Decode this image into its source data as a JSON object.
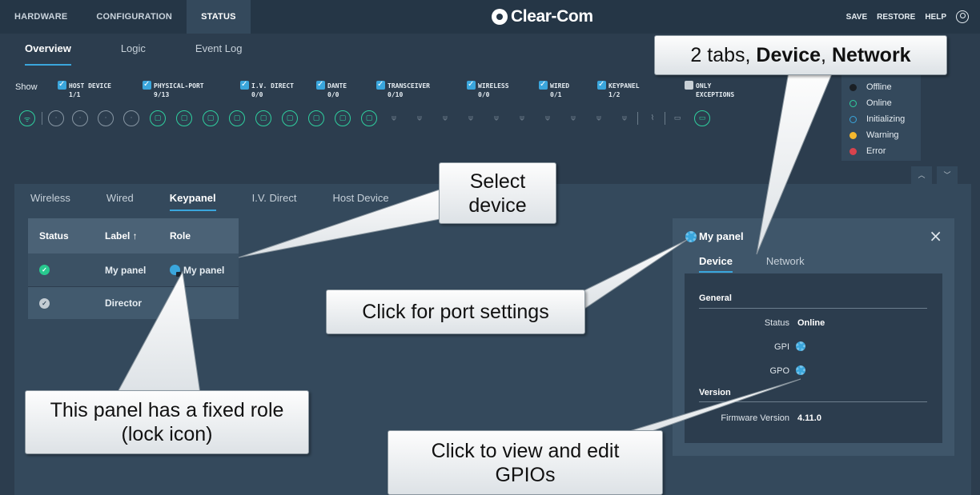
{
  "topnav": {
    "tabs": [
      {
        "label": "HARDWARE"
      },
      {
        "label": "CONFIGURATION"
      },
      {
        "label": "STATUS"
      }
    ],
    "brand": "Clear-Com",
    "actions": {
      "save": "SAVE",
      "restore": "RESTORE",
      "help": "HELP"
    }
  },
  "subnav": {
    "tabs": [
      {
        "label": "Overview"
      },
      {
        "label": "Logic"
      },
      {
        "label": "Event Log"
      }
    ]
  },
  "filters": {
    "show_label": "Show",
    "items": [
      {
        "label": "HOST DEVICE",
        "count": "1/1",
        "checked": true
      },
      {
        "label": "PHYSICAL-PORT",
        "count": "9/13",
        "checked": true
      },
      {
        "label": "I.V. DIRECT",
        "count": "0/0",
        "checked": true
      },
      {
        "label": "DANTE",
        "count": "0/0",
        "checked": true
      },
      {
        "label": "TRANSCEIVER",
        "count": "0/10",
        "checked": true
      },
      {
        "label": "WIRELESS",
        "count": "0/0",
        "checked": true
      },
      {
        "label": "WIRED",
        "count": "0/1",
        "checked": true
      },
      {
        "label": "KEYPANEL",
        "count": "1/2",
        "checked": true
      },
      {
        "label": "ONLY",
        "label2": "EXCEPTIONS",
        "checked": false
      }
    ]
  },
  "legend": {
    "items": [
      {
        "label": "Offline",
        "color": "#1a1f24"
      },
      {
        "label": "Online",
        "color": "#2fcf9f"
      },
      {
        "label": "Initializing",
        "color": "#3aa6dc"
      },
      {
        "label": "Warning",
        "color": "#f5b82e"
      },
      {
        "label": "Error",
        "color": "#d9434d"
      }
    ]
  },
  "device_tabs": [
    {
      "label": "Wireless"
    },
    {
      "label": "Wired"
    },
    {
      "label": "Keypanel"
    },
    {
      "label": "I.V. Direct"
    },
    {
      "label": "Host Device"
    }
  ],
  "device_table": {
    "headers": {
      "status": "Status",
      "label": "Label ↑",
      "role": "Role"
    },
    "rows": [
      {
        "label": "My panel",
        "role": "My panel",
        "status": "online"
      },
      {
        "label": "Director",
        "role": "",
        "status": "offline"
      }
    ]
  },
  "detail": {
    "title": "My panel",
    "tabs": [
      {
        "label": "Device"
      },
      {
        "label": "Network"
      }
    ],
    "general_heading": "General",
    "status_key": "Status",
    "status_value": "Online",
    "gpi_key": "GPI",
    "gpo_key": "GPO",
    "version_heading": "Version",
    "firmware_key": "Firmware Version",
    "firmware_value": "4.11.0"
  },
  "callouts": {
    "tabs_pre": "2 tabs, ",
    "tabs_device": "Device",
    "tabs_sep": ", ",
    "tabs_network": "Network",
    "select_device": "Select device",
    "port_settings": "Click for port settings",
    "fixed_role": "This panel has a fixed role (lock icon)",
    "gpios": "Click to view and edit GPIOs"
  }
}
